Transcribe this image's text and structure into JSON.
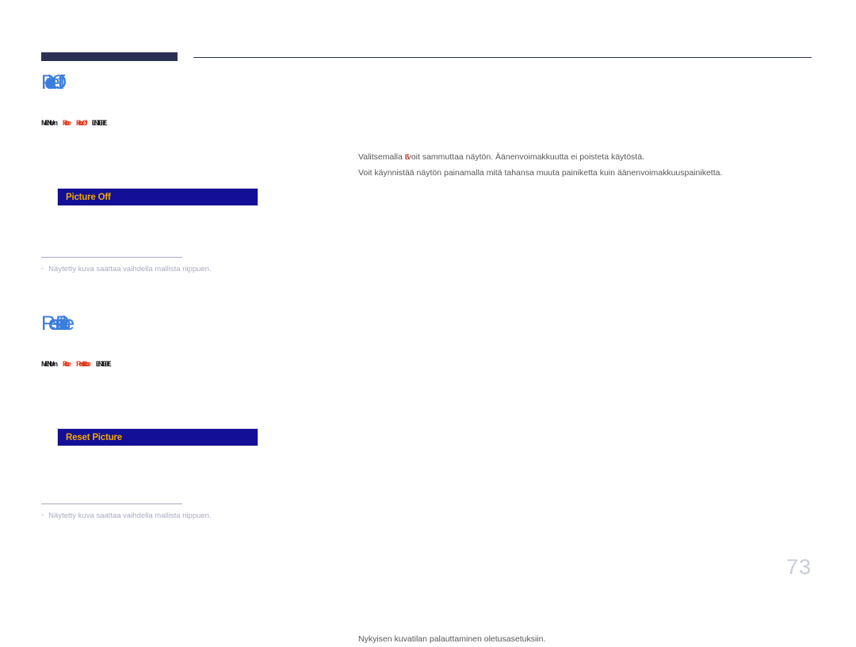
{
  "document": {
    "page_number": "73",
    "language": "fi"
  },
  "colors": {
    "heading_blue": "#3b7ddd",
    "banner_navy": "#130f96",
    "banner_text_gold": "#f0a800",
    "header_navy": "#2c3153",
    "body_gray": "#58585b",
    "footnote_gray": "#a9abc4",
    "key_red": "#e03c23",
    "page_number_gray": "#c9ccd8"
  },
  "sections": [
    {
      "heading": "Picture Off",
      "breadcrumb": {
        "menu": "MENU m",
        "path_1": "Picture",
        "path_2": "Picture Off",
        "enter": "ENTER E"
      },
      "banner_label": "Picture Off",
      "body_lines": [
        {
          "before": "Valitsemalla ",
          "key": "E",
          "after": "voit sammuttaa näytön. Äänenvoimakkuutta ei poisteta käytöstä."
        },
        {
          "before": "",
          "key": "",
          "after": "Voit käynnistää näytön painamalla mitä tahansa muuta painiketta kuin äänenvoimakkuuspainiketta."
        }
      ],
      "footnote": {
        "bullet": "-",
        "text": "Näytetty kuva saattaa vaihdella mallista riippuen."
      }
    },
    {
      "heading": "Reset Picture",
      "breadcrumb": {
        "menu": "MENU m",
        "path_1": "Picture",
        "path_2": "Reset Picture",
        "enter": "ENTER E"
      },
      "banner_label": "Reset Picture",
      "body_lines": [
        {
          "before": "",
          "key": "",
          "after": "Nykyisen kuvatilan palauttaminen oletusasetuksiin."
        }
      ],
      "footnote": {
        "bullet": "-",
        "text": "Näytetty kuva saattaa vaihdella mallista riippuen."
      }
    }
  ]
}
